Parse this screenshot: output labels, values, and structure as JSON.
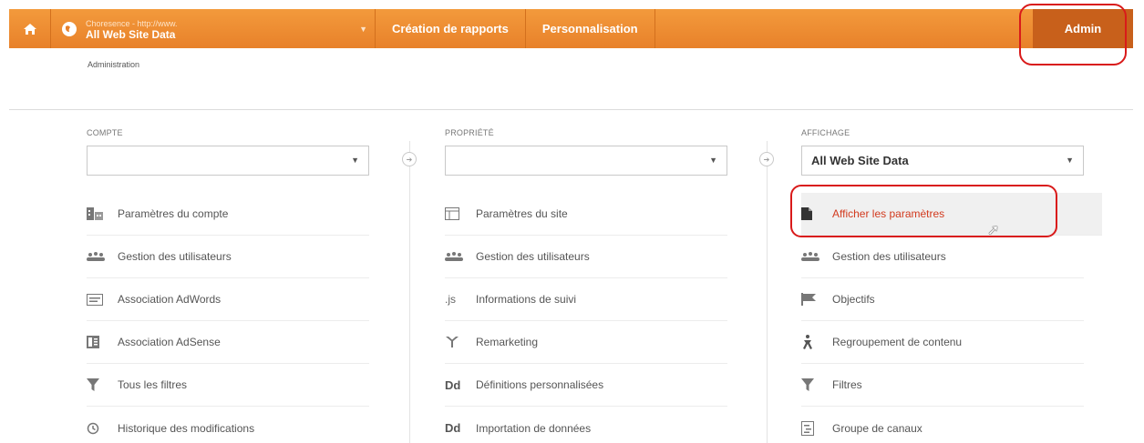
{
  "topbar": {
    "account_line1": "Choresence - http://www.",
    "account_line2": "All Web Site Data",
    "tabs": [
      "Création de rapports",
      "Personnalisation"
    ],
    "admin_label": "Admin"
  },
  "breadcrumb": "Administration",
  "columns": [
    {
      "label": "COMPTE",
      "select_value": "",
      "items": [
        {
          "icon": "building-icon",
          "label": "Paramètres du compte"
        },
        {
          "icon": "users-icon",
          "label": "Gestion des utilisateurs"
        },
        {
          "icon": "adwords-icon",
          "label": "Association AdWords"
        },
        {
          "icon": "adsense-icon",
          "label": "Association AdSense"
        },
        {
          "icon": "filter-icon",
          "label": "Tous les filtres"
        },
        {
          "icon": "history-icon",
          "label": "Historique des modifications"
        }
      ]
    },
    {
      "label": "PROPRIÉTÉ",
      "select_value": "",
      "items": [
        {
          "icon": "window-icon",
          "label": "Paramètres du site"
        },
        {
          "icon": "users-icon",
          "label": "Gestion des utilisateurs"
        },
        {
          "icon": "js-icon",
          "label": "Informations de suivi"
        },
        {
          "icon": "remarketing-icon",
          "label": "Remarketing"
        },
        {
          "icon": "dd-icon",
          "label": "Définitions personnalisées"
        },
        {
          "icon": "dd-icon",
          "label": "Importation de données"
        }
      ]
    },
    {
      "label": "AFFICHAGE",
      "select_value": "All Web Site Data",
      "items": [
        {
          "icon": "document-icon",
          "label": "Afficher les paramètres"
        },
        {
          "icon": "users-icon",
          "label": "Gestion des utilisateurs"
        },
        {
          "icon": "flag-icon",
          "label": "Objectifs"
        },
        {
          "icon": "person-icon",
          "label": "Regroupement de contenu"
        },
        {
          "icon": "filter-icon",
          "label": "Filtres"
        },
        {
          "icon": "channel-icon",
          "label": "Groupe de canaux"
        }
      ]
    }
  ],
  "colors": {
    "accent": "#e8812a",
    "admin_bg": "#c8601b",
    "highlight": "#d91a1a"
  }
}
